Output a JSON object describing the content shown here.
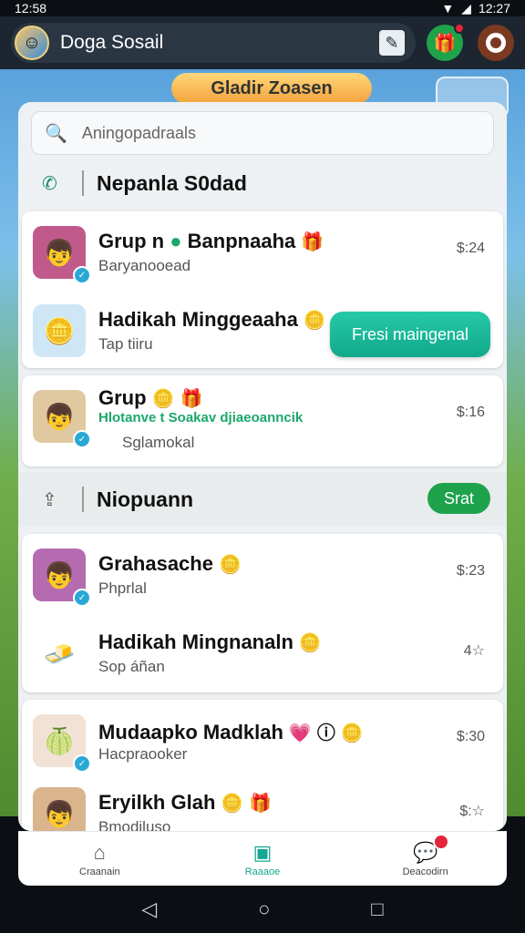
{
  "statusbar": {
    "time": "12:58",
    "right_text": "12:27"
  },
  "topbar": {
    "app_title": "Doga Sosail",
    "avatar_icon": "user-avatar-icon",
    "edit_icon": "edit-icon",
    "green_icon": "gift-icon",
    "ring_icon": "ring-icon"
  },
  "game": {
    "banner_text": "Gladir Zoasen"
  },
  "search": {
    "placeholder": "Aningopadraals"
  },
  "section1": {
    "icon": "phone-icon",
    "label": "Nepanla S0dad"
  },
  "section2": {
    "icon": "share-icon",
    "label": "Niopuann",
    "pill_label": "Srat"
  },
  "rows": [
    {
      "title": "Grup n",
      "title_tail": "Banpnaaha",
      "sub": "Baryanooead",
      "time": "$:24",
      "thumb": "boy-avatar"
    },
    {
      "title": "Hadikah Minggeaaha",
      "sub": "Tap tiiru",
      "cta": "Fresi maingenal",
      "thumb": "coins"
    },
    {
      "title": "Grup",
      "sub_green": "Hlotanve t Soakav djiaeoanncik",
      "sub": "Sglamokal",
      "time": "$:16",
      "thumb": "boy-avatar"
    },
    {
      "title": "Grahasache",
      "sub": "Phprlal",
      "time": "$:23",
      "thumb": "boy-avatar"
    },
    {
      "title": "Hadikah Mingnanaln",
      "sub": "Sop áñan",
      "time": "4",
      "thumb": "gold"
    },
    {
      "title": "Mudaapko Madklah",
      "sub": "Hacpraooker",
      "time": "$:30",
      "thumb": "melon"
    },
    {
      "title": "Eryilkh Glah",
      "sub": "Bmodiluso",
      "time": "$:",
      "thumb": "boy-avatar"
    }
  ],
  "bottomnav": [
    {
      "label": "Craanain",
      "icon": "home-icon"
    },
    {
      "label": "Raaaoe",
      "icon": "store-icon"
    },
    {
      "label": "Deacodirn",
      "icon": "chat-icon"
    }
  ]
}
